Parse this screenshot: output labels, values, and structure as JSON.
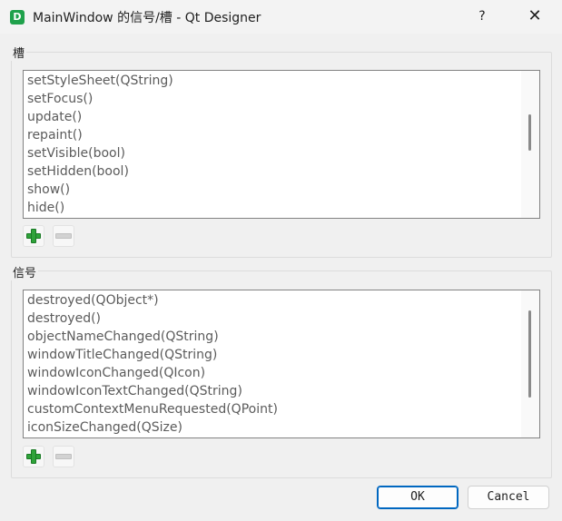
{
  "window": {
    "title": "MainWindow 的信号/槽 - Qt Designer",
    "app_icon_letter": "D",
    "help_label": "?",
    "close_label": "✕"
  },
  "slots": {
    "group_title": "槽",
    "items": [
      "setStyleSheet(QString)",
      "setFocus()",
      "update()",
      "repaint()",
      "setVisible(bool)",
      "setHidden(bool)",
      "show()",
      "hide()"
    ]
  },
  "signals": {
    "group_title": "信号",
    "items": [
      "destroyed(QObject*)",
      "destroyed()",
      "objectNameChanged(QString)",
      "windowTitleChanged(QString)",
      "windowIconChanged(QIcon)",
      "windowIconTextChanged(QString)",
      "customContextMenuRequested(QPoint)",
      "iconSizeChanged(QSize)"
    ]
  },
  "buttons": {
    "ok": "OK",
    "cancel": "Cancel"
  },
  "icons": {
    "add": "plus-icon",
    "remove": "minus-icon",
    "app": "designer-app-icon"
  },
  "colors": {
    "add_green": "#2fa33a",
    "default_button_border": "#0067c0"
  }
}
